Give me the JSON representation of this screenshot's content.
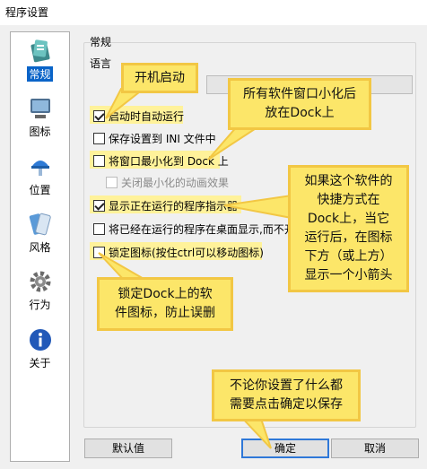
{
  "window": {
    "title": "程序设置"
  },
  "sidebar": {
    "items": [
      {
        "label": "常规",
        "icon": "general-icon"
      },
      {
        "label": "图标",
        "icon": "monitor-icon"
      },
      {
        "label": "位置",
        "icon": "lamp-icon"
      },
      {
        "label": "风格",
        "icon": "style-icon"
      },
      {
        "label": "行为",
        "icon": "gear-icon"
      },
      {
        "label": "关于",
        "icon": "info-icon"
      }
    ]
  },
  "main": {
    "section_title": "常规",
    "language_label": "语言",
    "options": [
      {
        "label": "启动时自动运行",
        "checked": true,
        "enabled": true
      },
      {
        "label": "保存设置到 INI 文件中",
        "checked": false,
        "enabled": true
      },
      {
        "label": "将窗口最小化到 Dock 上",
        "checked": false,
        "enabled": true
      },
      {
        "label": "关闭最小化的动画效果",
        "checked": false,
        "enabled": false
      },
      {
        "label": "显示正在运行的程序指示器",
        "checked": true,
        "enabled": true
      },
      {
        "label": "将已经在运行的程序在桌面显示,而不开",
        "checked": false,
        "enabled": true
      },
      {
        "label": "锁定图标(按住ctrl可以移动图标)",
        "checked": false,
        "enabled": true
      }
    ]
  },
  "buttons": {
    "default": "默认值",
    "ok": "确定",
    "cancel": "取消"
  },
  "callouts": {
    "autostart": "开机启动",
    "minimize": [
      "所有软件窗口小化后",
      "放在Dock上"
    ],
    "indicator": [
      "如果这个软件的",
      "快捷方式在",
      "Dock上，当它",
      "运行后，在图标",
      "下方（或上方）",
      "显示一个小箭头"
    ],
    "lock": [
      "锁定Dock上的软",
      "件图标，防止误删"
    ],
    "save": [
      "不论你设置了什么都",
      "需要点击确定以保存"
    ]
  },
  "colors": {
    "highlight": "#fff29a",
    "callout_fill": "#fce669",
    "callout_border": "#f2c744",
    "accent": "#2f78d8"
  }
}
